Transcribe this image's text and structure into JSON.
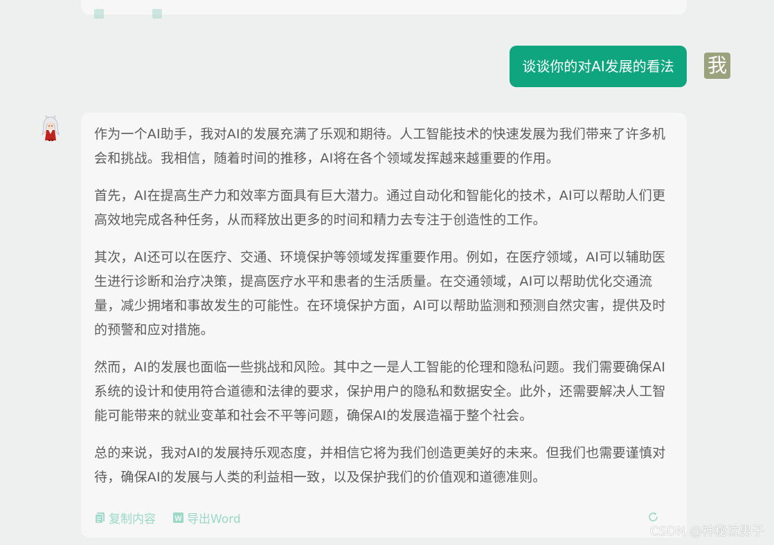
{
  "user_message": {
    "text": "谈谈你的对AI发展的看法",
    "avatar_label": "我",
    "bubble_color": "#0fa67f",
    "avatar_color": "#9ba17c"
  },
  "assistant_message": {
    "paragraphs": [
      "作为一个AI助手，我对AI的发展充满了乐观和期待。人工智能技术的快速发展为我们带来了许多机会和挑战。我相信，随着时间的推移，AI将在各个领域发挥越来越重要的作用。",
      "首先，AI在提高生产力和效率方面具有巨大潜力。通过自动化和智能化的技术，AI可以帮助人们更高效地完成各种任务，从而释放出更多的时间和精力去专注于创造性的工作。",
      "其次，AI还可以在医疗、交通、环境保护等领域发挥重要作用。例如，在医疗领域，AI可以辅助医生进行诊断和治疗决策，提高医疗水平和患者的生活质量。在交通领域，AI可以帮助优化交通流量，减少拥堵和事故发生的可能性。在环境保护方面，AI可以帮助监测和预测自然灾害，提供及时的预警和应对措施。",
      "然而，AI的发展也面临一些挑战和风险。其中之一是人工智能的伦理和隐私问题。我们需要确保AI系统的设计和使用符合道德和法律的要求，保护用户的隐私和数据安全。此外，还需要解决人工智能可能带来的就业变革和社会不平等问题，确保AI的发展造福于整个社会。",
      "总的来说，我对AI的发展持乐观态度，并相信它将为我们创造更美好的未来。但我们也需要谨慎对待，确保AI的发展与人类的利益相一致，以及保护我们的价值观和道德准则。"
    ],
    "actions": {
      "copy_label": "复制内容",
      "export_label": "导出Word"
    },
    "action_color": "#9bd8c7"
  },
  "watermark": "CSDN @神秘泣男子",
  "icons": {
    "copy": "copy-icon",
    "export": "word-icon",
    "refresh": "refresh-icon",
    "bot_avatar": "anime-character-avatar"
  }
}
